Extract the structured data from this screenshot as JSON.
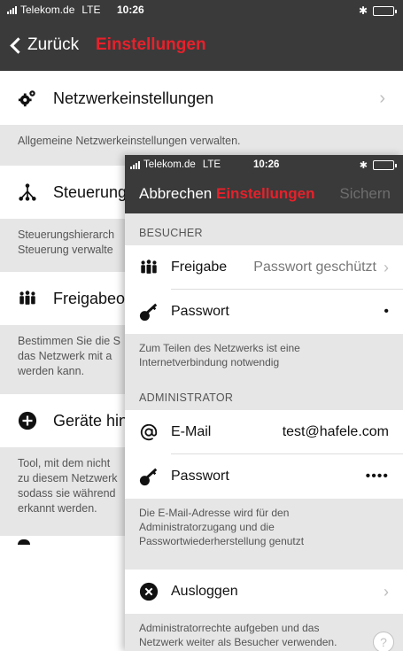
{
  "back_screen": {
    "status": {
      "carrier": "Telekom.de",
      "network": "LTE",
      "time": "10:26"
    },
    "nav": {
      "back_label": "Zurück",
      "title": "Einstellungen"
    },
    "items": [
      {
        "label": "Netzwerkeinstellungen",
        "icon": "gears-icon",
        "description": "Allgemeine Netzwerkeinstellungen verwalten."
      },
      {
        "label": "Steuerung",
        "icon": "hierarchy-icon",
        "description": "Steuerungshierarch\nSteuerung verwalte"
      },
      {
        "label": "Freigabeop",
        "icon": "people-icon",
        "description": "Bestimmen Sie die S\ndas Netzwerk mit a\nwerden kann."
      },
      {
        "label": "Geräte hin",
        "icon": "plus-circle-icon",
        "description": "Tool, mit dem nicht\nzu diesem Netzwerk\nsodass sie während\nerkannt werden."
      }
    ]
  },
  "front_screen": {
    "status": {
      "carrier": "Telekom.de",
      "network": "LTE",
      "time": "10:26"
    },
    "nav": {
      "cancel_label": "Abbrechen",
      "title": "Einstellungen",
      "save_label": "Sichern"
    },
    "visitor": {
      "header": "BESUCHER",
      "share_label": "Freigabe",
      "share_value": "Passwort geschützt",
      "password_label": "Passwort",
      "password_value": "•",
      "note": "Zum Teilen des Netzwerks ist eine Internetverbindung notwendig"
    },
    "admin": {
      "header": "ADMINISTRATOR",
      "email_label": "E-Mail",
      "email_value": "test@hafele.com",
      "password_label": "Passwort",
      "password_value": "••••",
      "note": "Die E-Mail-Adresse wird für den Administratorzugang und die Passwortwiederherstellung genutzt"
    },
    "logout": {
      "label": "Ausloggen",
      "note": "Administratorrechte aufgeben und das Netzwerk weiter als Besucher verwenden."
    },
    "help_label": "?"
  },
  "colors": {
    "nav_bg": "#3a3a3a",
    "accent": "#e8202a",
    "section_bg": "#e6e6e6"
  }
}
